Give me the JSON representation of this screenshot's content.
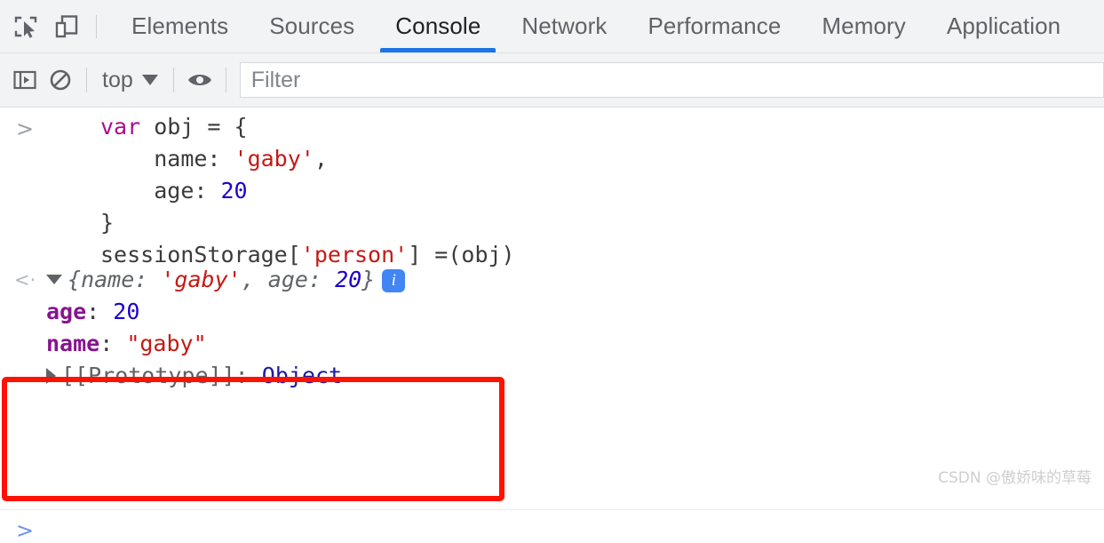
{
  "tabbar": {
    "icons": [
      {
        "name": "inspect-element-icon",
        "label": "Inspect element"
      },
      {
        "name": "device-toolbar-icon",
        "label": "Toggle device toolbar"
      }
    ],
    "tabs": [
      {
        "label": "Elements",
        "active": false
      },
      {
        "label": "Sources",
        "active": false
      },
      {
        "label": "Console",
        "active": true
      },
      {
        "label": "Network",
        "active": false
      },
      {
        "label": "Performance",
        "active": false
      },
      {
        "label": "Memory",
        "active": false
      },
      {
        "label": "Application",
        "active": false
      }
    ],
    "active_tab": "Console",
    "accent_color": "#1a73e8",
    "background": "#f1f3f4"
  },
  "filterbar": {
    "sidebar_toggle": "console-sidebar-icon",
    "clear_console": "clear-console-icon",
    "context": "top",
    "context_caret": "chevron-down-icon",
    "eye": "live-expression-icon",
    "filter_placeholder": "Filter"
  },
  "console": {
    "input": {
      "prompt": ">",
      "lines": [
        {
          "indent": 0,
          "tokens": [
            {
              "t": "var ",
              "c": "kw"
            },
            {
              "t": "obj = {",
              "c": "plain"
            }
          ]
        },
        {
          "indent": 1,
          "tokens": [
            {
              "t": "name: ",
              "c": "plain"
            },
            {
              "t": "'gaby'",
              "c": "str"
            },
            {
              "t": ",",
              "c": "plain"
            }
          ]
        },
        {
          "indent": 1,
          "tokens": [
            {
              "t": "age: ",
              "c": "plain"
            },
            {
              "t": "20",
              "c": "num"
            }
          ]
        },
        {
          "indent": 0,
          "tokens": [
            {
              "t": "}",
              "c": "plain"
            }
          ]
        },
        {
          "indent": 0,
          "tokens": [
            {
              "t": "sessionStorage[",
              "c": "plain"
            },
            {
              "t": "'person'",
              "c": "str"
            },
            {
              "t": "] =(obj)",
              "c": "plain"
            }
          ]
        }
      ],
      "raw": "var obj = {\n    name: 'gaby',\n    age: 20\n}\nsessionStorage['person'] =(obj)"
    },
    "result": {
      "return_marker": "<·",
      "expanded": true,
      "preview_open": "{",
      "preview_close": "}",
      "preview_name_key": "name: ",
      "preview_name_value": "'gaby'",
      "preview_sep": ", ",
      "preview_age_key": "age: ",
      "preview_age_value": "20",
      "info_badge": "i",
      "properties": [
        {
          "key": "age",
          "value": "20",
          "kind": "number"
        },
        {
          "key": "name",
          "value": "\"gaby\"",
          "kind": "string"
        }
      ],
      "prototype_label": "[[Prototype]]",
      "prototype_sep": ": ",
      "prototype_value": "Object"
    },
    "bottom_prompt": ">"
  },
  "annotation": {
    "box_color": "#ff1200"
  },
  "watermark": "CSDN @傲娇味的草莓"
}
